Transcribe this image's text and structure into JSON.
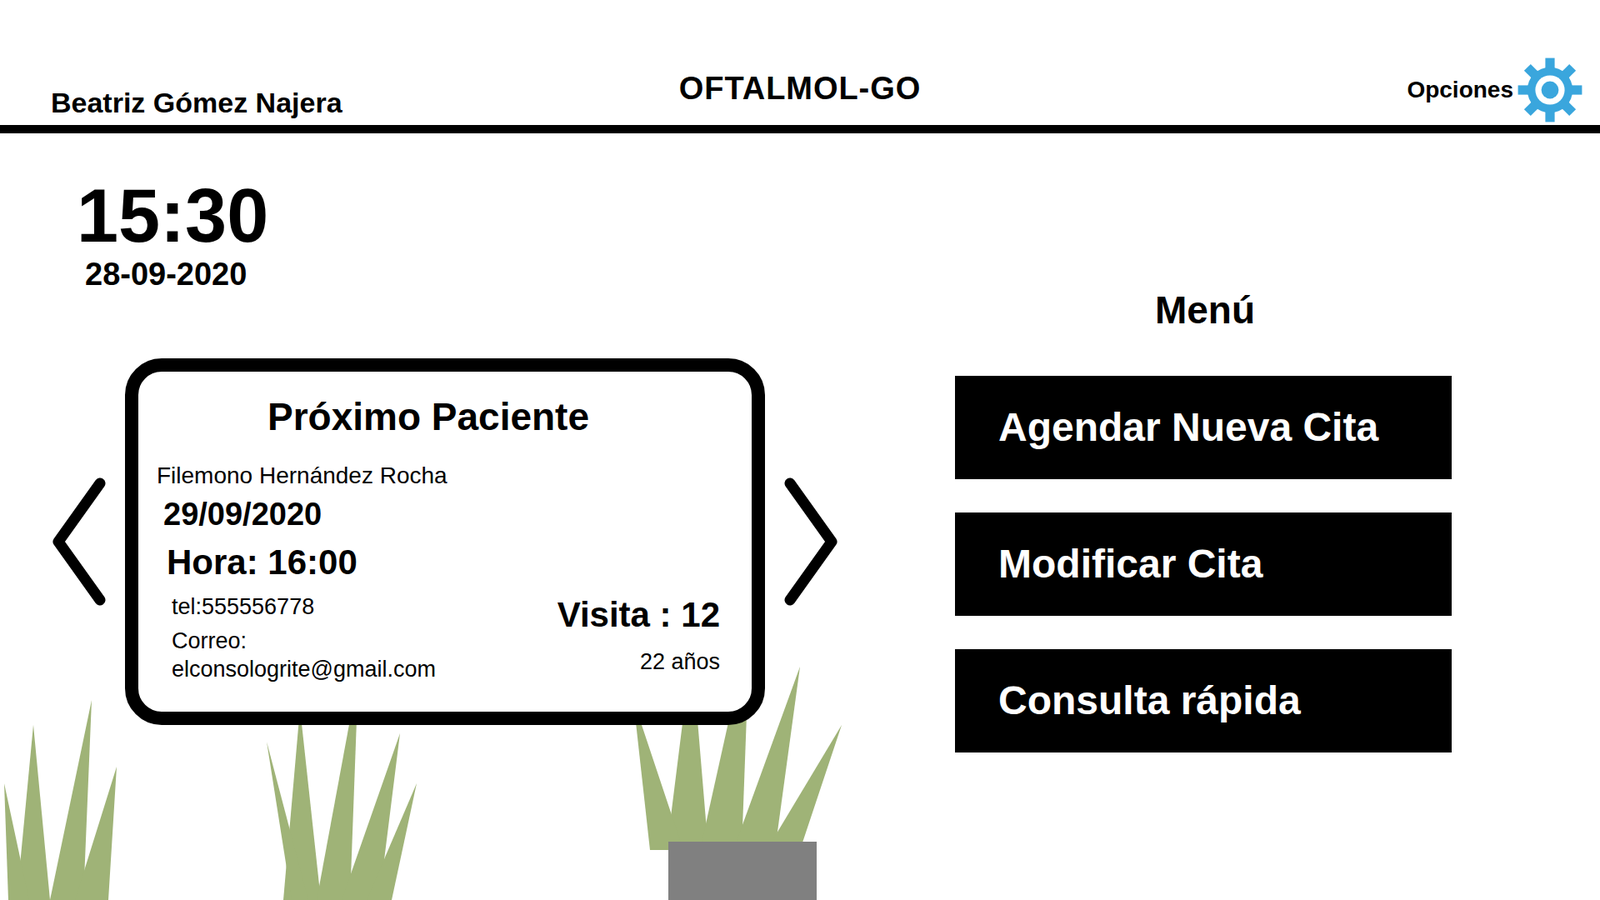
{
  "header": {
    "user": "Beatriz Gómez Najera",
    "title": "OFTALMOL-GO",
    "options": "Opciones"
  },
  "clock": {
    "time": "15:30",
    "date": "28-09-2020"
  },
  "next_patient": {
    "heading": "Próximo Paciente",
    "name": "Filemono Hernández Rocha",
    "date": "29/09/2020",
    "time": "Hora: 16:00",
    "phone": "tel:555556778",
    "visit": "Visita : 12",
    "email_label": "Correo:",
    "email": "elconsologrite@gmail.com",
    "age": "22 años"
  },
  "menu": {
    "title": "Menú",
    "buttons": [
      "Agendar Nueva Cita",
      "Modificar Cita",
      "Consulta rápida"
    ]
  }
}
